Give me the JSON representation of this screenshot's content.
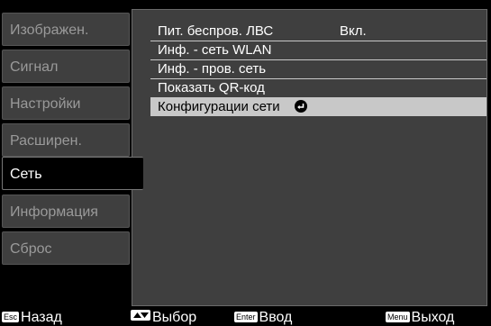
{
  "sidebar": {
    "items": [
      {
        "label": "Изображен."
      },
      {
        "label": "Сигнал"
      },
      {
        "label": "Настройки"
      },
      {
        "label": "Расширен."
      },
      {
        "label": "Сеть",
        "active": true
      },
      {
        "label": "Информация"
      },
      {
        "label": "Сброс"
      }
    ]
  },
  "menu": {
    "items": [
      {
        "label": "Пит. беспров. ЛВС",
        "value": "Вкл."
      },
      {
        "label": "Инф. - сеть WLAN"
      },
      {
        "label": "Инф. - пров. сеть"
      },
      {
        "label": "Показать QR-код"
      },
      {
        "label": "Конфигурации сети",
        "icon": "enter-icon",
        "selected": true
      }
    ]
  },
  "footer": {
    "back": {
      "key": "Esc",
      "label": "Назад"
    },
    "select": {
      "key_icon": "up-down-arrows-icon",
      "label": "Выбор"
    },
    "enter": {
      "key": "Enter",
      "label": "Ввод"
    },
    "exit": {
      "key": "Menu",
      "label": "Выход"
    }
  },
  "colors": {
    "background": "#000000",
    "panel": "#3f3f3f",
    "inactive_text": "#9a9a9a",
    "selection": "#c8c8c8"
  }
}
